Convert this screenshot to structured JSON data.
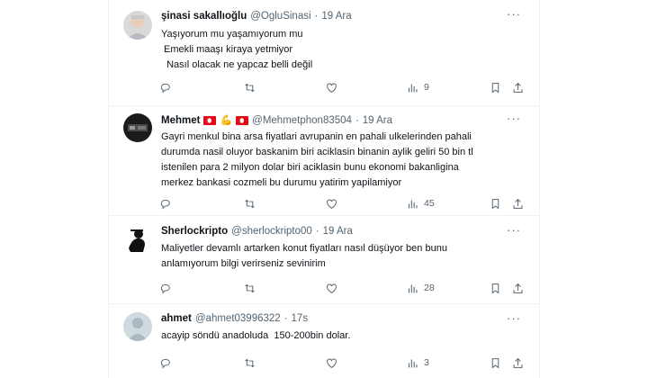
{
  "tweets": [
    {
      "name": "şinasi sakallıoğlu",
      "handle": "@OgluSinasi",
      "separator": "·",
      "time": "19 Ara",
      "lines": [
        "Yaşıyorum mu yaşamıyorum mu",
        " Emekli maaşı kiraya yetmiyor",
        "  Nasıl olacak ne yapcaz belli değil"
      ],
      "views": "9"
    },
    {
      "name": "Mehmet",
      "handle": "@Mehmetphon83504",
      "separator": "·",
      "time": "19 Ara",
      "lines": [
        "Gayri menkul bina arsa fiyatlari avrupanin en pahali ulkelerinden pahali",
        "durumda nasil oluyor baskanim biri aciklasin binanin aylik geliri 50 bin tl",
        "istenilen para 2 milyon dolar biri aciklasin bunu ekonomi bakanligina",
        "merkez bankasi cozmeli bu durumu yatirim yapilamiyor"
      ],
      "views": "45"
    },
    {
      "name": "Sherlockripto",
      "handle": "@sherlockripto00",
      "separator": "·",
      "time": "19 Ara",
      "lines": [
        "Maliyetler devamlı artarken konut fiyatları nasıl düşüyor ben bunu",
        "anlamıyorum bilgi verirseniz sevinirim"
      ],
      "views": "28"
    },
    {
      "name": "ahmet",
      "handle": "@ahmet03996322",
      "separator": "·",
      "time": "17s",
      "lines": [
        "acayip söndü anadoluda  150-200bin dolar."
      ],
      "views": "3"
    }
  ],
  "icons": {
    "more": "more-icon",
    "reply": "reply-icon",
    "retweet": "retweet-icon",
    "like": "like-icon",
    "views": "views-icon",
    "bookmark": "bookmark-icon",
    "share": "share-icon"
  },
  "colors": {
    "text": "#0f1419",
    "secondary": "#536471",
    "border": "#eff3f4"
  }
}
